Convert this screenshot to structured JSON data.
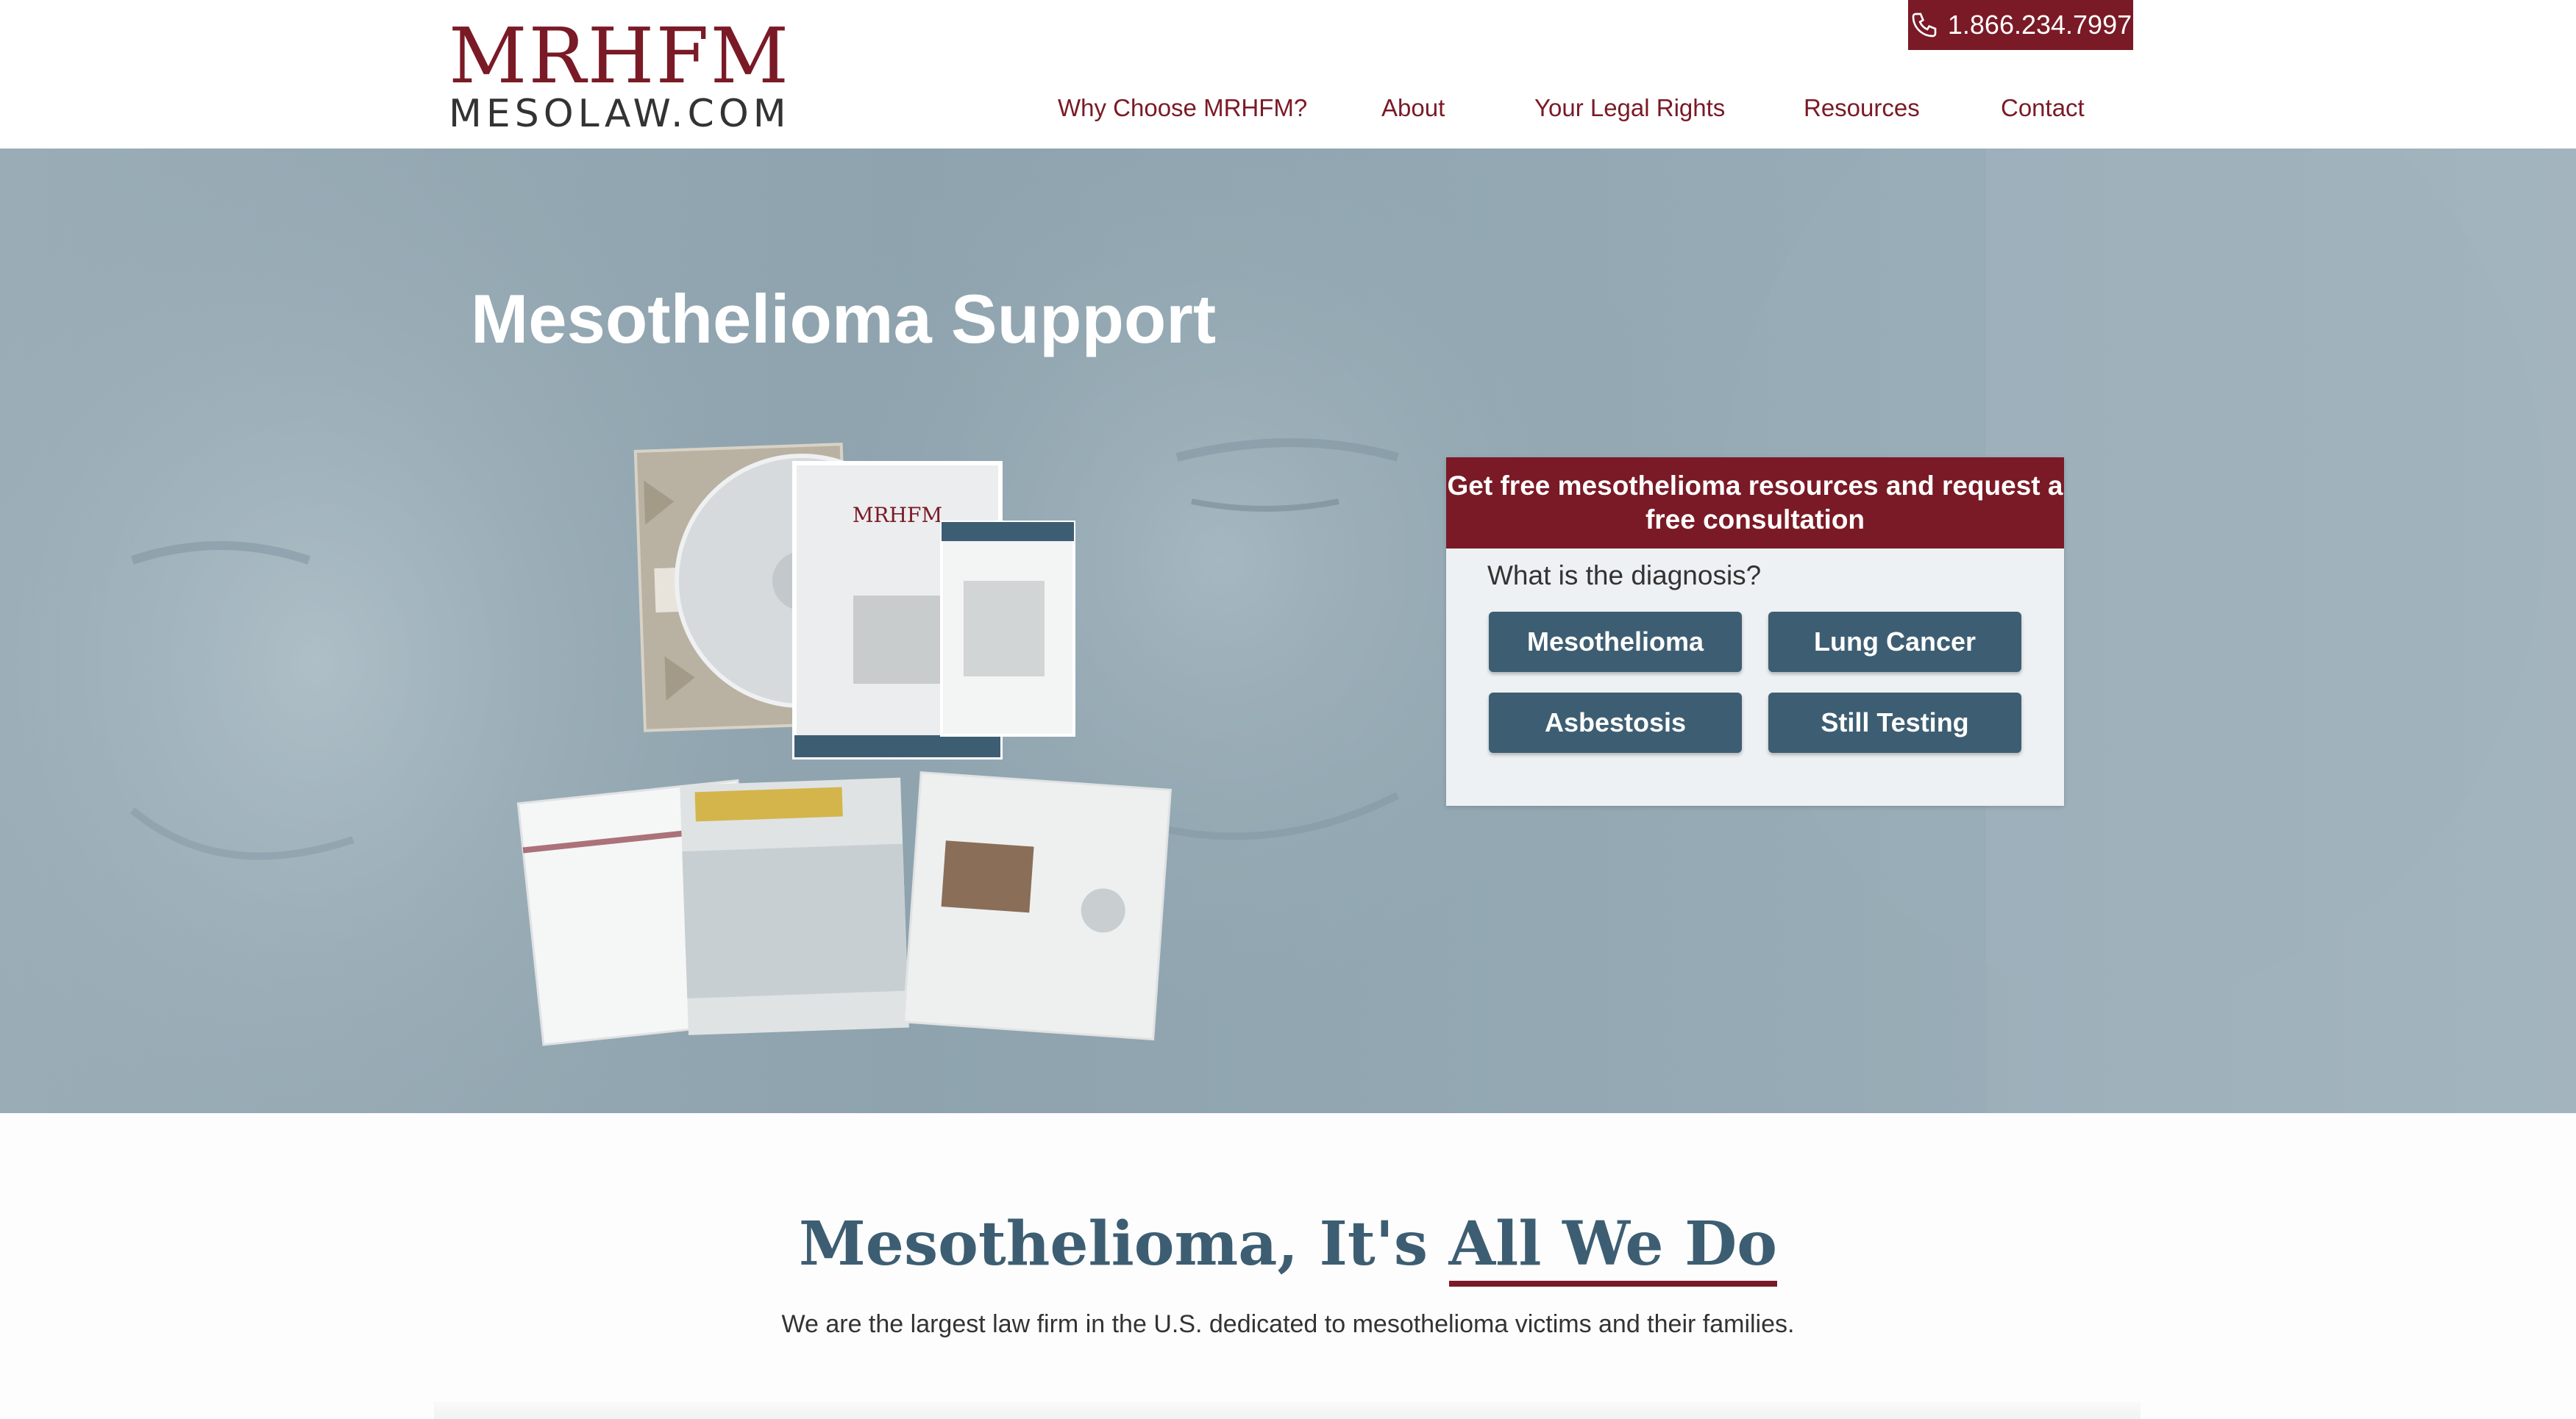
{
  "header": {
    "logo_main": "MRHFM",
    "logo_sub": "MESOLAW.COM",
    "phone": "1.866.234.7997",
    "nav": [
      "Why Choose MRHFM?",
      "About",
      "Your Legal Rights",
      "Resources",
      "Contact"
    ]
  },
  "hero": {
    "title": "Mesothelioma Support",
    "form": {
      "header": "Get free mesothelioma resources and request a free consultation",
      "question": "What is the diagnosis?",
      "options": [
        "Mesothelioma",
        "Lung Cancer",
        "Asbestosis",
        "Still Testing"
      ]
    }
  },
  "section": {
    "title_start": "Mesothelioma, It's ",
    "title_emphasis": "All We Do",
    "text": "We are the largest law firm in the U.S. dedicated to mesothelioma victims and their families."
  },
  "colors": {
    "brand": "#7a1a26",
    "button": "#3d5e72",
    "hero_bg": "#93a8b3"
  }
}
